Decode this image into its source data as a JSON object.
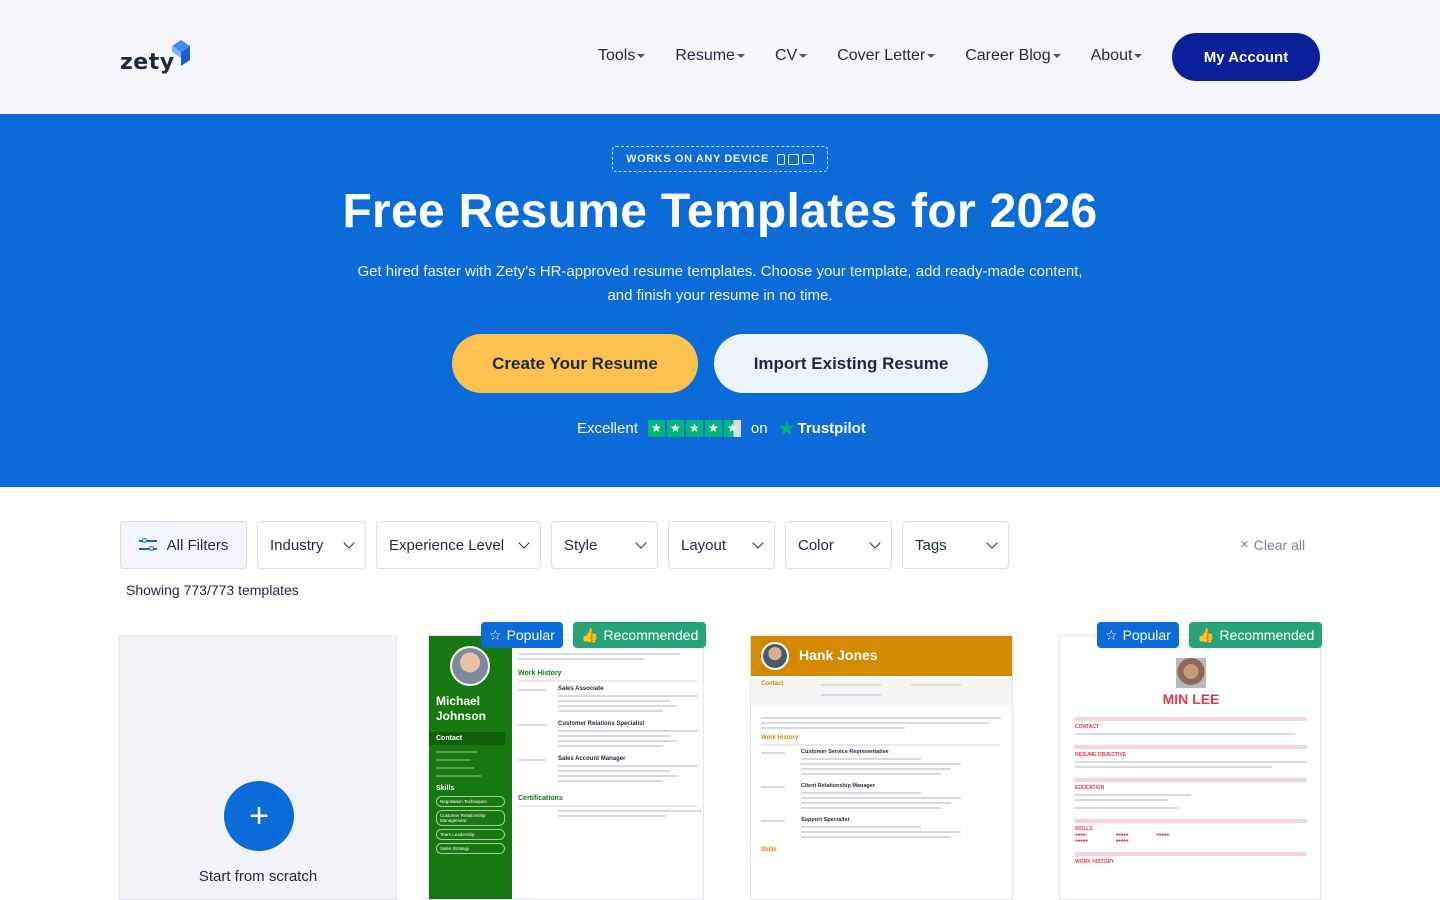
{
  "header": {
    "logo": "zety",
    "nav": [
      "Tools",
      "Resume",
      "CV",
      "Cover Letter",
      "Career Blog",
      "About"
    ],
    "account_button": "My Account"
  },
  "hero": {
    "badge": "WORKS ON ANY DEVICE",
    "title": "Free Resume Templates for 2026",
    "subtitle_line1": "Get hired faster with Zety’s HR-approved resume templates. Choose your template, add ready-made content,",
    "subtitle_line2": "and finish your resume in no time.",
    "create_button": "Create Your Resume",
    "import_button": "Import Existing Resume",
    "rating_label": "Excellent",
    "rating_on": "on",
    "trustpilot": "Trustpilot",
    "rating_stars": 4.5
  },
  "filters": {
    "all": "All Filters",
    "items": [
      "Industry",
      "Experience Level",
      "Style",
      "Layout",
      "Color",
      "Tags"
    ],
    "clear_all": "Clear all",
    "showing": "Showing 773/773 templates"
  },
  "cards": {
    "scratch_label": "Start from scratch",
    "badges": {
      "popular": "Popular",
      "recommended": "Recommended"
    },
    "resume1": {
      "name_first": "Michael",
      "name_last": "Johnson",
      "contact": "Contact",
      "skills": "Skills",
      "skill_items": [
        "Negotiation Techniques",
        "Customer Relationship Management",
        "Team Leadership",
        "Sales Strategy"
      ],
      "work_history": "Work History",
      "jobs": [
        "Sales Associate",
        "Customer Relations Specialist",
        "Sales Account Manager"
      ],
      "certifications": "Certifications",
      "colors": {
        "sidebar": "#17780f"
      }
    },
    "resume2": {
      "name": "Hank Jones",
      "contact": "Contact",
      "work_history": "Work History",
      "jobs": [
        "Customer Service Representative",
        "Client Relationship Manager",
        "Support Specialist"
      ],
      "skills": "Skills",
      "colors": {
        "header": "#d48a00"
      }
    },
    "resume3": {
      "name": "MIN LEE",
      "sections": [
        "CONTACT",
        "RESUME OBJECTIVE",
        "EDUCATION",
        "SKILLS",
        "WORK HISTORY"
      ],
      "colors": {
        "accent": "#e0394a"
      }
    }
  },
  "colors": {
    "hero_bg": "#0b6bd9",
    "account_btn": "#0b1f9a",
    "create_btn": "#fbc24f",
    "popular_badge": "#0b6bd9",
    "recommended_badge": "#27a37a",
    "trustpilot_green": "#00b67a"
  }
}
